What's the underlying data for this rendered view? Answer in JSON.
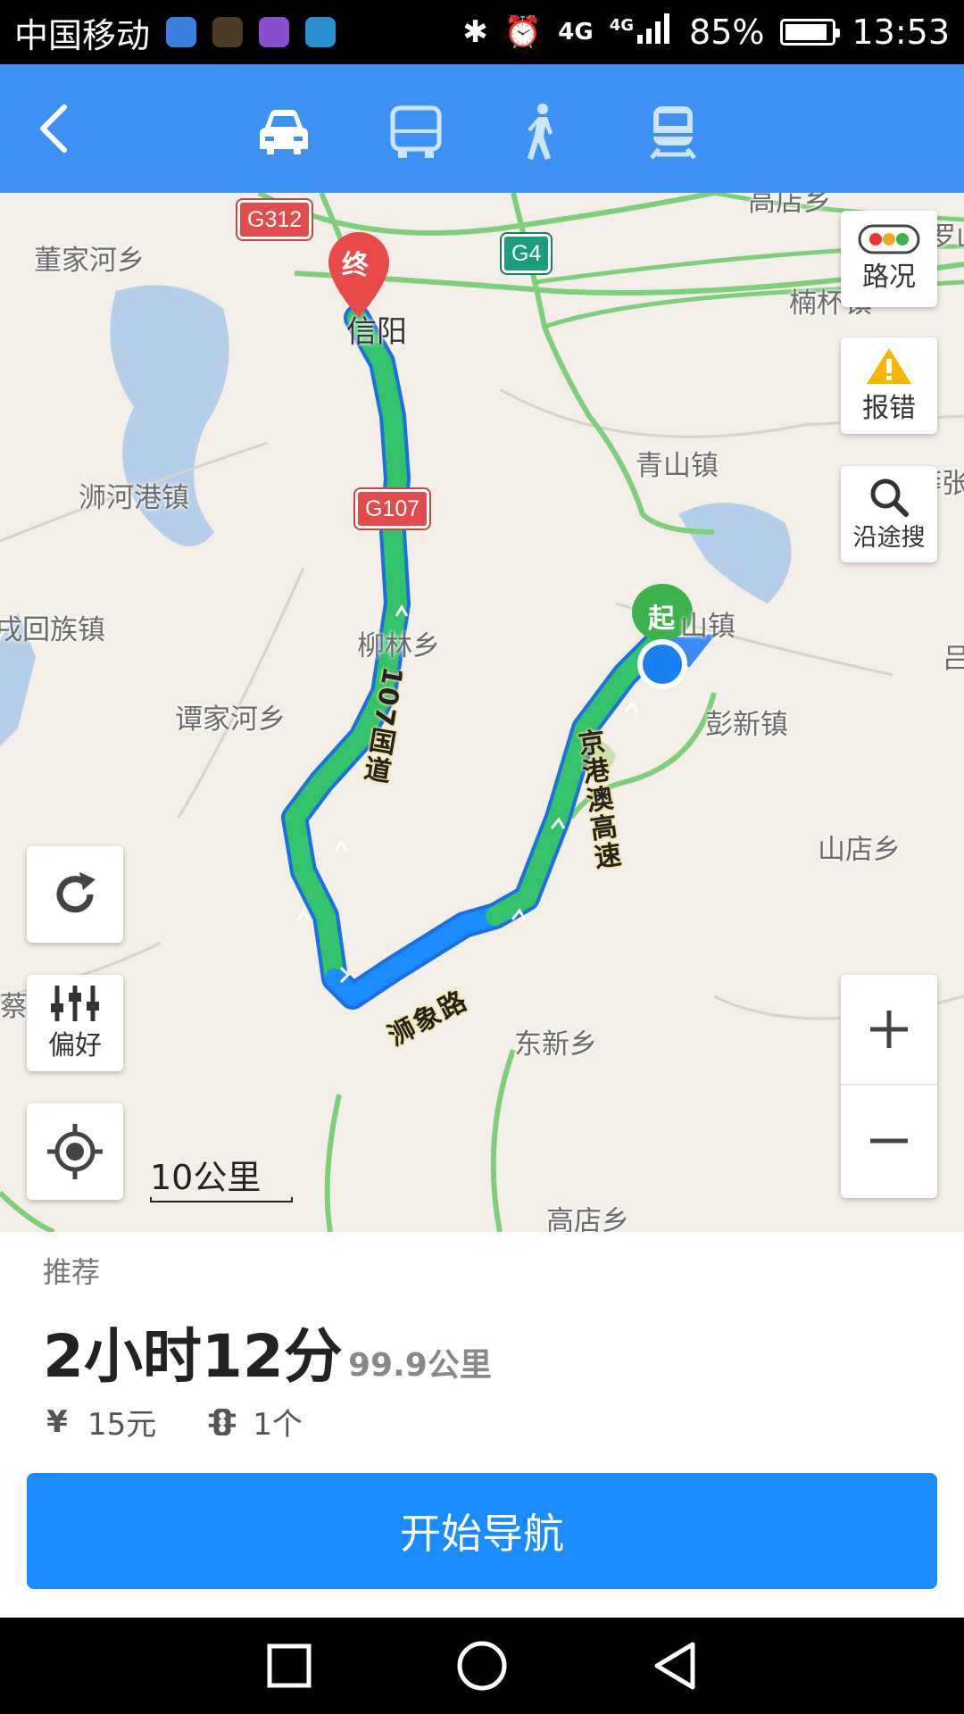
{
  "status_bar": {
    "carrier": "中国移动",
    "network_a": "4G",
    "network_b": "4G",
    "battery": "85%",
    "time": "13:53"
  },
  "header": {
    "modes": [
      "car-icon",
      "bus-icon",
      "walk-icon",
      "train-icon"
    ],
    "active_mode": "car-icon",
    "bg_color": "#3e92f3"
  },
  "map": {
    "places": {
      "dongjiahe": "董家河乡",
      "xinyang": "信阳",
      "shihegang": "浉河港镇",
      "qingshan": "青山镇",
      "huizu": "戌回族镇",
      "liulin": "柳林乡",
      "tanjiahe": "谭家河乡",
      "pengxin": "彭新镇",
      "shandian": "山店乡",
      "dongxin": "东新乡",
      "gaodian": "高店乡",
      "nanwan": "楠杯镇",
      "top": "高店乡",
      "shan_town": "山镇",
      "cai": "蔡",
      "lv": "吕",
      "luo": "罗山",
      "mang": "莽张"
    },
    "shields": {
      "g312": "G312",
      "g4": "G4",
      "g107": "G107"
    },
    "road_labels": {
      "r107": "107国道",
      "jgao": "京港澳高速",
      "shixiang": "浉象路"
    },
    "markers": {
      "end": "终",
      "start": "起"
    },
    "buttons": {
      "traffic": "路况",
      "report": "报错",
      "search_along": "沿途搜",
      "preference": "偏好"
    },
    "scale": "10公里"
  },
  "panel": {
    "recommend": "推荐",
    "duration": "2小时12分",
    "distance": "99.9公里",
    "toll": "15元",
    "lights": "1个",
    "start_nav": "开始导航",
    "accent": "#1a8cff"
  }
}
